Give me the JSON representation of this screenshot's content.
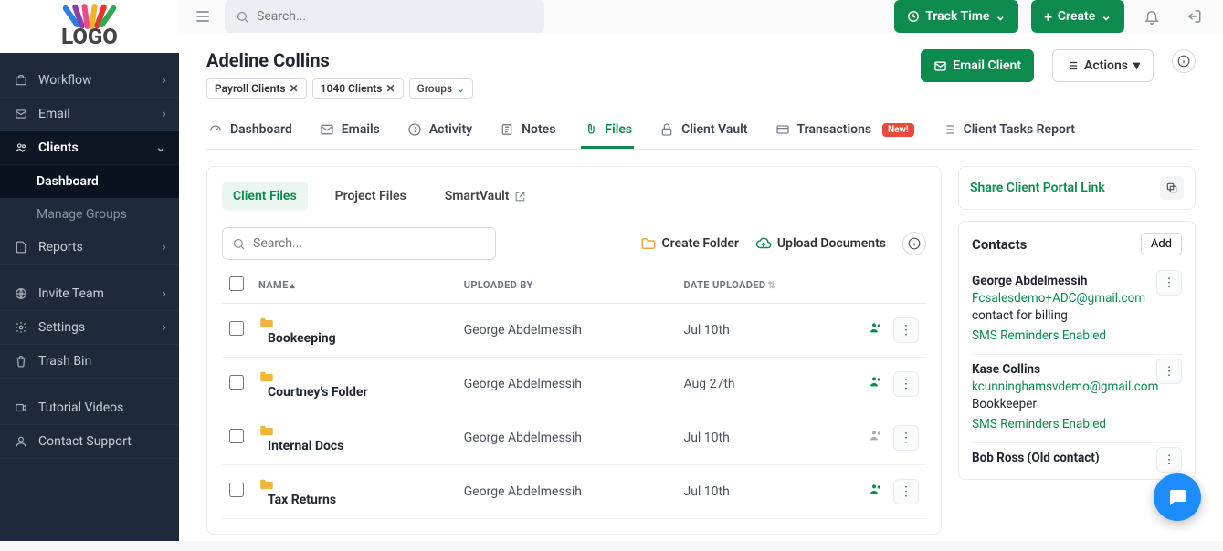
{
  "logo_text": "LOGO",
  "sidebar": {
    "items": [
      {
        "label": "Workflow"
      },
      {
        "label": "Email"
      },
      {
        "label": "Clients"
      },
      {
        "label": "Reports"
      },
      {
        "label": "Invite Team"
      },
      {
        "label": "Settings"
      },
      {
        "label": "Trash Bin"
      },
      {
        "label": "Tutorial Videos"
      },
      {
        "label": "Contact Support"
      }
    ],
    "sub_items": [
      {
        "label": "Dashboard"
      },
      {
        "label": "Manage Groups"
      }
    ]
  },
  "header": {
    "search_placeholder": "Search...",
    "track_time": "Track Time",
    "create": "Create"
  },
  "page_title": "Adeline Collins",
  "chips": [
    {
      "label": "Payroll Clients"
    },
    {
      "label": "1040 Clients"
    }
  ],
  "groups_chip": "Groups",
  "buttons": {
    "email_client": "Email Client",
    "actions": "Actions"
  },
  "tabs": [
    {
      "label": "Dashboard"
    },
    {
      "label": "Emails"
    },
    {
      "label": "Activity"
    },
    {
      "label": "Notes"
    },
    {
      "label": "Files"
    },
    {
      "label": "Client Vault"
    },
    {
      "label": "Transactions",
      "new": "New!"
    },
    {
      "label": "Client Tasks Report"
    }
  ],
  "subtabs": [
    {
      "label": "Client Files"
    },
    {
      "label": "Project Files"
    },
    {
      "label": "SmartVault"
    }
  ],
  "file_search_placeholder": "Search...",
  "toolbar": {
    "create_folder": "Create Folder",
    "upload_documents": "Upload Documents"
  },
  "columns": {
    "name": "NAME",
    "uploaded_by": "UPLOADED BY",
    "date_uploaded": "DATE UPLOADED"
  },
  "files": [
    {
      "name": "Bookeeping",
      "uploaded_by": "George Abdelmessih",
      "date": "Jul 10th",
      "shared": true
    },
    {
      "name": "Courtney's Folder",
      "uploaded_by": "George Abdelmessih",
      "date": "Aug 27th",
      "shared": true
    },
    {
      "name": "Internal Docs",
      "uploaded_by": "George Abdelmessih",
      "date": "Jul 10th",
      "shared": false
    },
    {
      "name": "Tax Returns",
      "uploaded_by": "George Abdelmessih",
      "date": "Jul 10th",
      "shared": true
    }
  ],
  "share_link_text": "Share Client Portal Link",
  "contacts": {
    "heading": "Contacts",
    "add": "Add",
    "items": [
      {
        "name": "George Abdelmessih",
        "email": "Fcsalesdemo+ADC@gmail.com",
        "role": "contact for billing",
        "sms": "SMS Reminders Enabled"
      },
      {
        "name": "Kase Collins",
        "email": "kcunninghamsvdemo@gmail.com",
        "role": "Bookkeeper",
        "sms": "SMS Reminders Enabled"
      },
      {
        "name": "Bob Ross (Old contact)"
      }
    ]
  }
}
